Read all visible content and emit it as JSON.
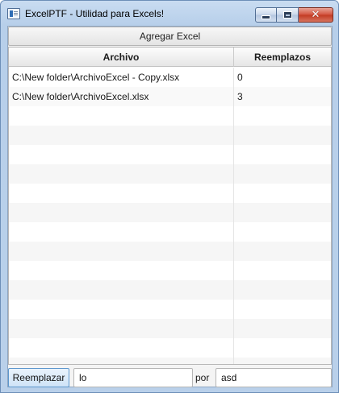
{
  "window": {
    "title": "ExcelPTF - Utilidad para Excels!",
    "controls": {
      "minimize": "minimize-icon",
      "maximize": "maximize-icon",
      "close": "close-icon",
      "close_glyph": "✕"
    }
  },
  "toolbar": {
    "add_label": "Agregar Excel"
  },
  "table": {
    "columns": [
      "Archivo",
      "Reemplazos"
    ],
    "rows": [
      {
        "archivo": "C:\\New folder\\ArchivoExcel - Copy.xlsx",
        "reemplazos": "0"
      },
      {
        "archivo": "C:\\New folder\\ArchivoExcel.xlsx",
        "reemplazos": "3"
      }
    ]
  },
  "replace_bar": {
    "button_label": "Reemplazar",
    "search_value": "lo",
    "por_label": "por",
    "replace_value": "asd"
  }
}
